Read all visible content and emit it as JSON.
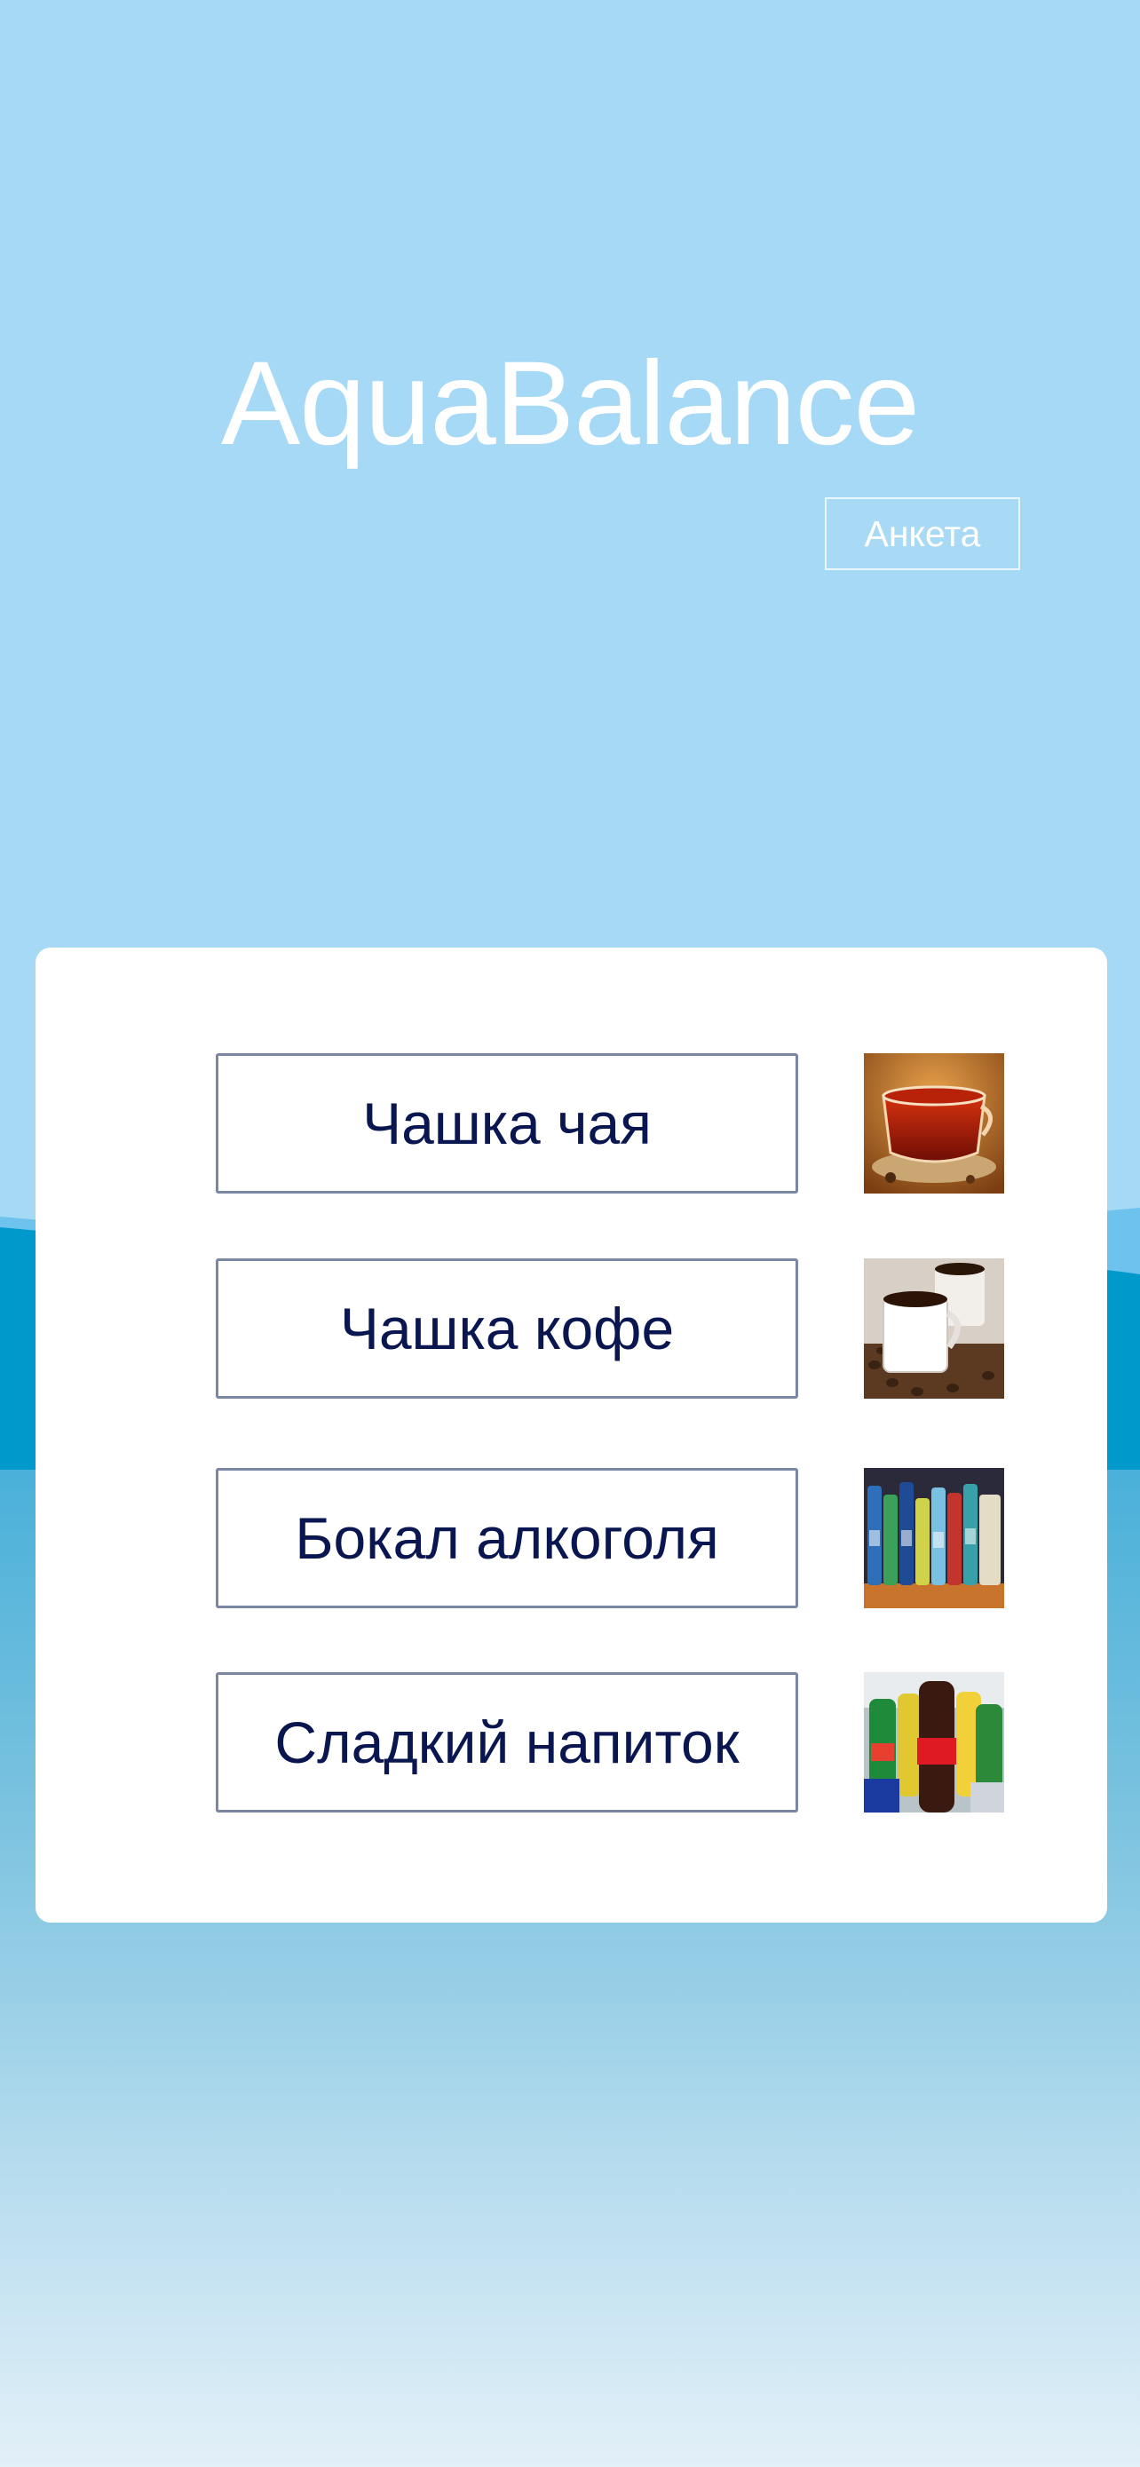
{
  "app": {
    "title": "AquaBalance"
  },
  "header": {
    "survey_label": "Анкета"
  },
  "drinks": [
    {
      "label": "Чашка чая",
      "image": "tea-cup-image"
    },
    {
      "label": "Чашка кофе",
      "image": "coffee-cups-image"
    },
    {
      "label": "Бокал алкоголя",
      "image": "alcohol-bottles-image"
    },
    {
      "label": "Сладкий напиток",
      "image": "soda-bottles-image"
    }
  ],
  "colors": {
    "sky": "#a6d9f5",
    "water": "#0096c9",
    "button_text": "#0a1650",
    "button_border": "#7b86a3",
    "card": "#ffffff"
  }
}
